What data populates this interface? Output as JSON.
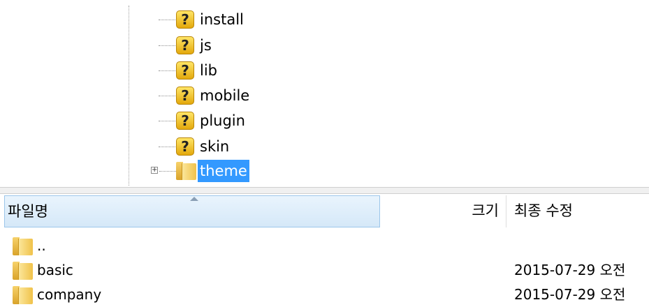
{
  "tree": {
    "items": [
      {
        "label": "install",
        "icon": "unknown-folder-icon",
        "selected": false
      },
      {
        "label": "js",
        "icon": "unknown-folder-icon",
        "selected": false
      },
      {
        "label": "lib",
        "icon": "unknown-folder-icon",
        "selected": false
      },
      {
        "label": "mobile",
        "icon": "unknown-folder-icon",
        "selected": false
      },
      {
        "label": "plugin",
        "icon": "unknown-folder-icon",
        "selected": false
      },
      {
        "label": "skin",
        "icon": "unknown-folder-icon",
        "selected": false
      },
      {
        "label": "theme",
        "icon": "folder-icon",
        "selected": true,
        "expander": "+"
      }
    ],
    "unknown_glyph": "?",
    "selection_color": "#3399ff"
  },
  "list": {
    "columns": {
      "name": "파일명",
      "size": "크기",
      "modified": "최종 수정"
    },
    "rows": [
      {
        "name": "..",
        "date": ""
      },
      {
        "name": "basic",
        "date": "2015-07-29 오전"
      },
      {
        "name": "company",
        "date": "2015-07-29 오전"
      }
    ]
  }
}
